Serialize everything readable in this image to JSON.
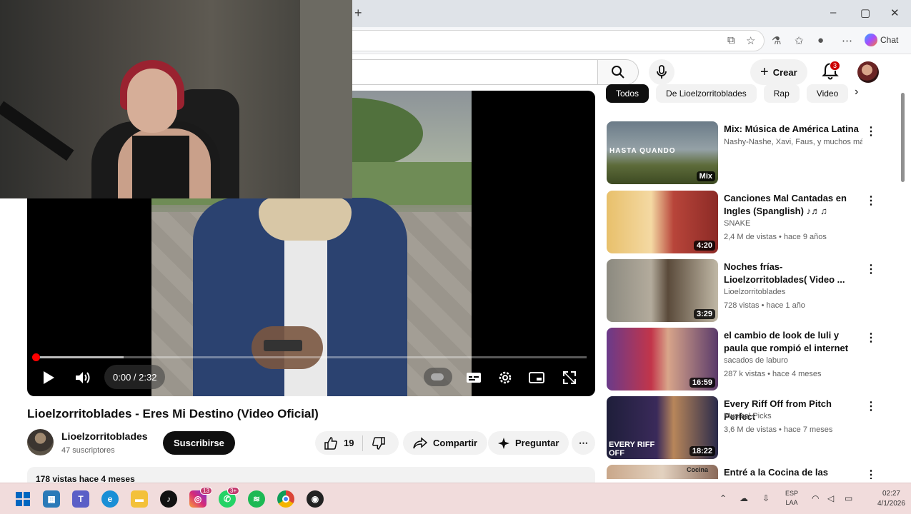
{
  "browser": {
    "new_tab": "+",
    "window_controls": [
      "–",
      "▢",
      "✕"
    ],
    "copilot_label": "Chat"
  },
  "youtube": {
    "create_label": "Crear",
    "notifications_count": "3",
    "chips": [
      "Todos",
      "De Lioelzorritoblades",
      "Rap",
      "Video"
    ],
    "player": {
      "time": "0:00 / 2:32",
      "progress_fraction": 0.0,
      "buffer_fraction": 0.16
    },
    "video_title": "Lioelzorritoblades - Eres Mi Destino (Video Oficial)",
    "channel_name": "Lioelzorritoblades",
    "channel_subs": "47 suscriptores",
    "subscribe_label": "Suscribirse",
    "like_count": "19",
    "share_label": "Compartir",
    "ask_label": "Preguntar",
    "description_preview": "178 vistas  hace 4 meses",
    "recommendations": [
      {
        "title": "Mix: Música de América Latina",
        "channel": "Nashy-Nashe, Xavi, Faus, y muchos más",
        "meta": "",
        "badge": "Mix",
        "thumb_text": "HASTA QUANDO"
      },
      {
        "title": "Canciones Mal Cantadas en Ingles (Spanglish) ♪♬♫",
        "channel": "SNAKE",
        "meta": "2,4 M de vistas • hace 9 años",
        "badge": "4:20",
        "thumb_text": ""
      },
      {
        "title": "Noches frías- Lioelzorritoblades( Video ...",
        "channel": "Lioelzorritoblades",
        "meta": "728 vistas • hace 1 año",
        "badge": "3:29",
        "thumb_text": ""
      },
      {
        "title": "el cambio de look de luli y paula que rompió el internet",
        "channel": "sacados de laburo",
        "meta": "287 k vistas • hace 4 meses",
        "badge": "16:59",
        "thumb_text": ""
      },
      {
        "title": "Every Riff Off from Pitch Perfect",
        "channel": "Musical Picks",
        "meta": "3,6 M de vistas • hace 7 meses",
        "badge": "18:22",
        "thumb_text": "EVERY RIFF OFF"
      },
      {
        "title": "Entré a la Cocina de las",
        "channel": "",
        "meta": "",
        "badge": "",
        "thumb_text": "Cocina"
      }
    ]
  },
  "taskbar": {
    "teams_badge": "13",
    "whatsapp_badge": "3+",
    "lang_top": "ESP",
    "lang_bottom": "LAA",
    "time": "02:27",
    "date": "4/1/2026"
  },
  "colors": {
    "youtube_red": "#ff0000",
    "taskbar_bg": "#f1dcdc"
  }
}
